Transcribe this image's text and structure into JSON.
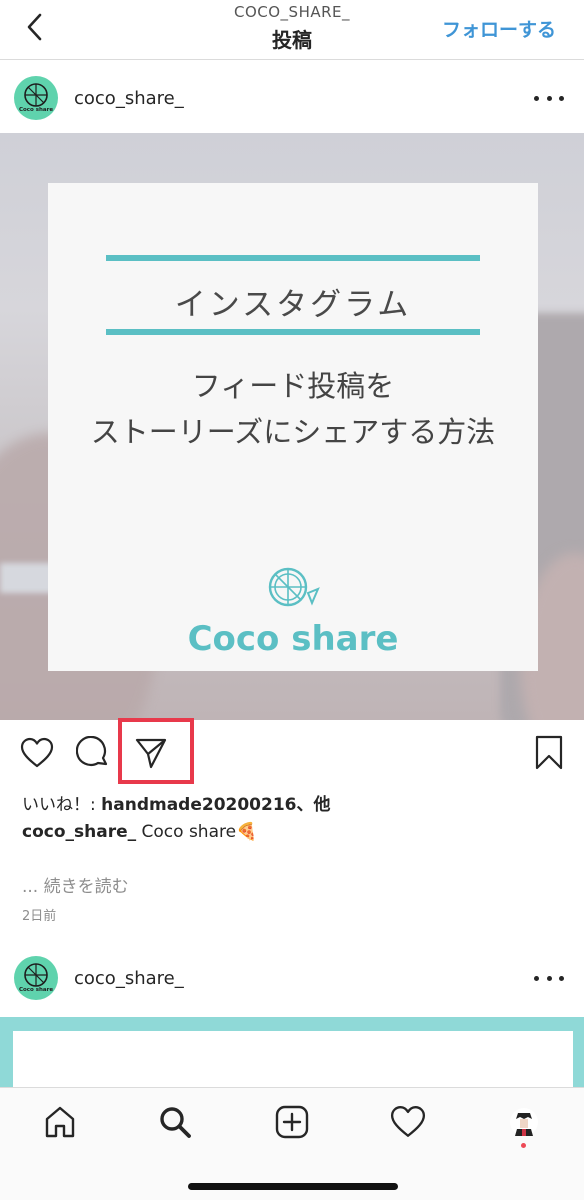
{
  "header": {
    "back_icon": "chevron-left-icon",
    "account_label": "COCO_SHARE_",
    "title": "投稿",
    "follow_label": "フォローする"
  },
  "post": {
    "username": "coco_share_",
    "avatar_text": "Coco share",
    "more_icon": "more-horizontal-icon",
    "image": {
      "heading": "インスタグラム",
      "subtitle_line1": "フィード投稿を",
      "subtitle_line2": "ストーリーズにシェアする方法",
      "brand": "Coco share",
      "accent_color": "#5bbfc4"
    },
    "actions": {
      "like_icon": "heart-icon",
      "comment_icon": "comment-icon",
      "share_icon": "paper-plane-icon",
      "save_icon": "bookmark-icon",
      "highlight_color": "#e8394b"
    },
    "likes_prefix": "いいね！: ",
    "likes_user": "handmade20200216",
    "likes_suffix": "、他",
    "caption_user": "coco_share_",
    "caption_text": " Coco share🍕",
    "read_more": "... 続きを読む",
    "timestamp": "2日前"
  },
  "next_post": {
    "username": "coco_share_",
    "avatar_text": "Coco share"
  },
  "bottom_nav": {
    "items": [
      "home-icon",
      "search-icon",
      "add-post-icon",
      "activity-heart-icon",
      "profile-avatar-icon"
    ],
    "notification_color": "#ed4956"
  }
}
